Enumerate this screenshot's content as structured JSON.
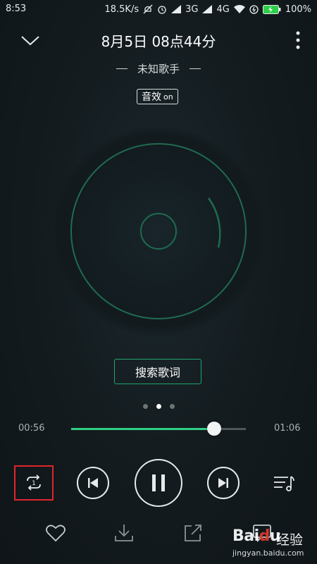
{
  "status_bar": {
    "time": "8:53",
    "net_speed": "18.5K/s",
    "network_3g": "3G",
    "network_4g": "4G",
    "battery": "100%"
  },
  "header": {
    "title": "8月5日 08点44分",
    "artist": "未知歌手",
    "effect_label": "音效",
    "effect_state": "on"
  },
  "lyrics": {
    "search_label": "搜索歌词"
  },
  "pager": {
    "count": 3,
    "active_index": 1
  },
  "progress": {
    "current": "00:56",
    "total": "01:06",
    "fraction": 0.818
  },
  "controls": {
    "loop_icon": "repeat-one-icon",
    "prev_icon": "previous-icon",
    "play_icon": "pause-icon",
    "next_icon": "next-icon",
    "playlist_icon": "playlist-icon"
  },
  "actions": {
    "favorite_icon": "heart-icon",
    "download_icon": "download-icon",
    "share_icon": "share-icon",
    "comment_icon": "comment-icon"
  },
  "watermark": {
    "brand_latin": "Bai",
    "brand_paw": "d",
    "brand_end": "u",
    "brand_cn": "经验",
    "url": "jingyan.baidu.com"
  },
  "colors": {
    "accent": "#2fcf82",
    "disc_ring": "#1f6b4f",
    "highlight_box": "#e0252a"
  }
}
